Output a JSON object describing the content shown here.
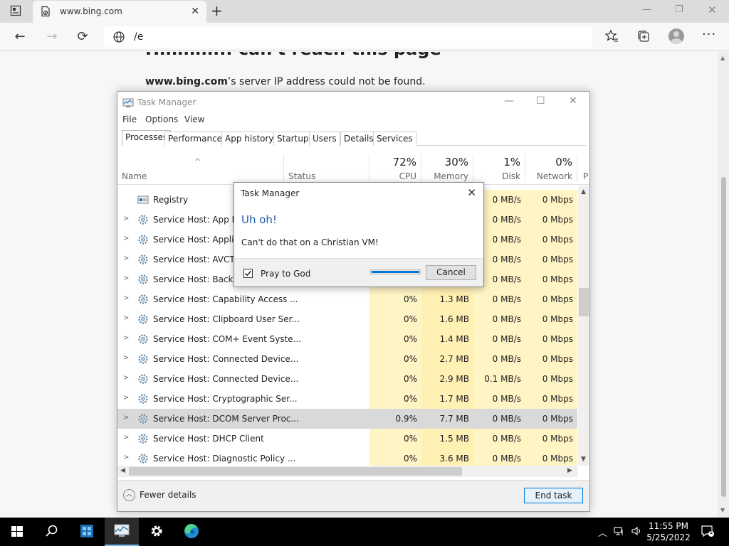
{
  "browser": {
    "tab_title": "www.bing.com",
    "address": "/e",
    "window_controls": [
      "minimize",
      "restore",
      "close"
    ]
  },
  "page": {
    "heading": "Hmmm... can't reach this page",
    "message_host": "www.bing.com",
    "message_rest": "’s server IP address could not be found."
  },
  "task_manager": {
    "title": "Task Manager",
    "menu": [
      "File",
      "Options",
      "View"
    ],
    "tabs": [
      "Processes",
      "Performance",
      "App history",
      "Startup",
      "Users",
      "Details",
      "Services"
    ],
    "columns": {
      "name": "Name",
      "status": "Status",
      "cpu_pct": "72%",
      "cpu": "CPU",
      "mem_pct": "30%",
      "mem": "Memory",
      "disk_pct": "1%",
      "disk": "Disk",
      "net_pct": "0%",
      "net": "Network",
      "power": "P"
    },
    "rows": [
      {
        "name": "Registry",
        "expandable": false,
        "cpu": "",
        "mem": "",
        "disk": "0 MB/s",
        "net": "0 Mbps"
      },
      {
        "name": "Service Host: App Rea",
        "expandable": true,
        "cpu": "",
        "mem": "",
        "disk": "0 MB/s",
        "net": "0 Mbps"
      },
      {
        "name": "Service Host: Applicat",
        "expandable": true,
        "cpu": "",
        "mem": "",
        "disk": "0 MB/s",
        "net": "0 Mbps"
      },
      {
        "name": "Service Host: AVCTP s",
        "expandable": true,
        "cpu": "",
        "mem": "",
        "disk": "0 MB/s",
        "net": "0 Mbps"
      },
      {
        "name": "Service Host: Backgro",
        "expandable": true,
        "cpu": "",
        "mem": "",
        "disk": "0 MB/s",
        "net": "0 Mbps"
      },
      {
        "name": "Service Host: Capability Access ...",
        "expandable": true,
        "cpu": "0%",
        "mem": "1.3 MB",
        "disk": "0 MB/s",
        "net": "0 Mbps"
      },
      {
        "name": "Service Host: Clipboard User Ser...",
        "expandable": true,
        "cpu": "0%",
        "mem": "1.6 MB",
        "disk": "0 MB/s",
        "net": "0 Mbps"
      },
      {
        "name": "Service Host: COM+ Event Syste...",
        "expandable": true,
        "cpu": "0%",
        "mem": "1.4 MB",
        "disk": "0 MB/s",
        "net": "0 Mbps"
      },
      {
        "name": "Service Host: Connected Device...",
        "expandable": true,
        "cpu": "0%",
        "mem": "2.7 MB",
        "disk": "0 MB/s",
        "net": "0 Mbps"
      },
      {
        "name": "Service Host: Connected Device...",
        "expandable": true,
        "cpu": "0%",
        "mem": "2.9 MB",
        "disk": "0.1 MB/s",
        "net": "0 Mbps"
      },
      {
        "name": "Service Host: Cryptographic Ser...",
        "expandable": true,
        "cpu": "0%",
        "mem": "1.7 MB",
        "disk": "0 MB/s",
        "net": "0 Mbps"
      },
      {
        "name": "Service Host: DCOM Server Proc...",
        "expandable": true,
        "selected": true,
        "cpu": "0.9%",
        "mem": "7.7 MB",
        "disk": "0 MB/s",
        "net": "0 Mbps"
      },
      {
        "name": "Service Host: DHCP Client",
        "expandable": true,
        "cpu": "0%",
        "mem": "1.5 MB",
        "disk": "0 MB/s",
        "net": "0 Mbps"
      },
      {
        "name": "Service Host: Diagnostic Policy ...",
        "expandable": true,
        "cpu": "0%",
        "mem": "3.6 MB",
        "disk": "0 MB/s",
        "net": "0 Mbps"
      }
    ],
    "fewer_details": "Fewer details",
    "end_task": "End task"
  },
  "dialog": {
    "title": "Task Manager",
    "heading": "Uh oh!",
    "message": "Can't do that on a Christian VM!",
    "checkbox_label": "Pray to God",
    "checkbox_checked": true,
    "progress": 1.0,
    "cancel": "Cancel"
  },
  "taskbar": {
    "time": "11:55 PM",
    "date": "5/25/2022",
    "notification_count": "1"
  },
  "colors": {
    "accent": "#0078d7",
    "heat_light": "#fff4c4",
    "heat_mem": "#fff0b3",
    "dialog_heading": "#1e5aa8"
  }
}
